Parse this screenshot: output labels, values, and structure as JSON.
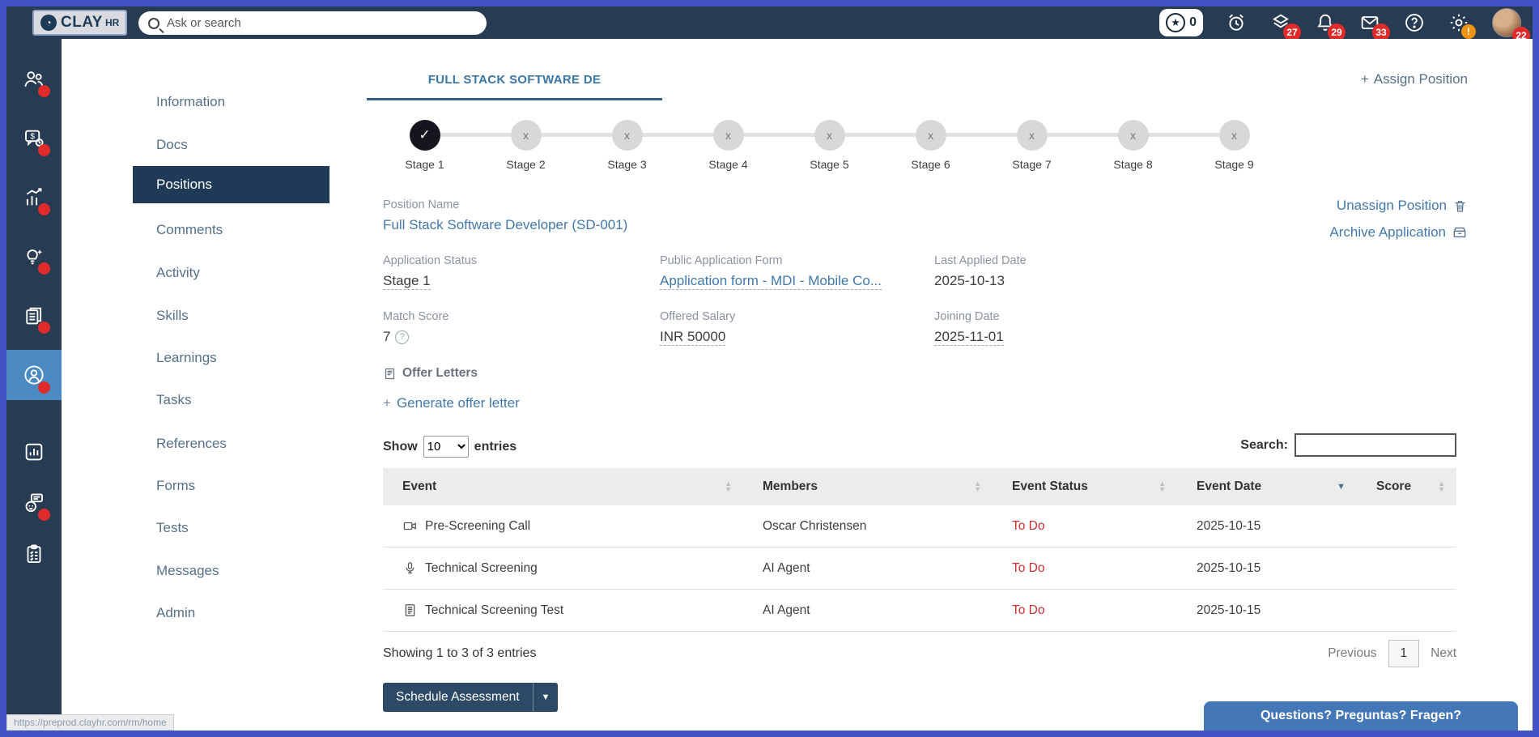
{
  "colors": {
    "frame_border": "#4353c4",
    "topbar_bg": "#273b52",
    "sidebar_selected_bg": "#4b8bc2",
    "subnav_selected_bg": "#1f3a57",
    "link_blue": "#4279ab",
    "tab_blue": "#3a76a8",
    "status_red": "#cb2e2e",
    "badge_red": "#e12a2a",
    "badge_orange": "#f0930f",
    "stage_done_bg": "#15151e",
    "stage_pending_bg": "#d8d8d8",
    "table_header_bg": "#ececec",
    "button_navy": "#2c4a66",
    "chat_bg": "#4377b8"
  },
  "topbar": {
    "logo_text": "CLAY",
    "logo_suffix": "HR",
    "search_placeholder": "Ask or search",
    "star_count": "0",
    "badge_layers": "27",
    "badge_bell": "29",
    "badge_mail": "33",
    "badge_gear": "!",
    "badge_avatar": "22"
  },
  "sidebar": {
    "items": [
      {
        "icon": "team-icon",
        "has_alert": true
      },
      {
        "icon": "billing-chat-icon",
        "has_alert": true
      },
      {
        "icon": "performance-chart-icon",
        "has_alert": true
      },
      {
        "icon": "idea-bulb-icon",
        "has_alert": true
      },
      {
        "icon": "documents-icon",
        "has_alert": true
      },
      {
        "icon": "people-profile-icon",
        "has_alert": true,
        "selected": true
      },
      {
        "icon": "analytics-icon",
        "has_alert": false
      },
      {
        "icon": "bot-assistant-icon",
        "has_alert": true
      },
      {
        "icon": "checklist-icon",
        "has_alert": false
      }
    ]
  },
  "subnav": {
    "items": [
      "Information",
      "Docs",
      "Positions",
      "Comments",
      "Activity",
      "Skills",
      "Learnings",
      "Tasks",
      "References",
      "Forms",
      "Tests",
      "Messages",
      "Admin"
    ],
    "active_item": "Positions"
  },
  "main": {
    "tab_label": "FULL STACK SOFTWARE DE",
    "assign_position_label": "Assign Position",
    "stages": [
      {
        "label": "Stage 1",
        "marker": "✓",
        "state": "done"
      },
      {
        "label": "Stage 2",
        "marker": "x",
        "state": "pending"
      },
      {
        "label": "Stage 3",
        "marker": "x",
        "state": "pending"
      },
      {
        "label": "Stage 4",
        "marker": "x",
        "state": "pending"
      },
      {
        "label": "Stage 5",
        "marker": "x",
        "state": "pending"
      },
      {
        "label": "Stage 6",
        "marker": "x",
        "state": "pending"
      },
      {
        "label": "Stage 7",
        "marker": "x",
        "state": "pending"
      },
      {
        "label": "Stage 8",
        "marker": "x",
        "state": "pending"
      },
      {
        "label": "Stage 9",
        "marker": "x",
        "state": "pending"
      }
    ],
    "position_name": {
      "label": "Position Name",
      "value": "Full Stack Software Developer (SD-001)"
    },
    "unassign_label": "Unassign Position",
    "archive_label": "Archive Application",
    "fields": {
      "application_status": {
        "label": "Application Status",
        "value": "Stage 1"
      },
      "public_application_form": {
        "label": "Public Application Form",
        "value": "Application form - MDI - Mobile Co..."
      },
      "last_applied_date": {
        "label": "Last Applied Date",
        "value": "2025-10-13"
      },
      "match_score": {
        "label": "Match Score",
        "value": "7"
      },
      "offered_salary": {
        "label": "Offered Salary",
        "value": "INR 50000"
      },
      "joining_date": {
        "label": "Joining Date",
        "value": "2025-11-01"
      }
    },
    "offer_letters_label": "Offer Letters",
    "generate_offer_label": "Generate offer letter",
    "table": {
      "show_label": "Show",
      "page_size": "10",
      "entries_label": "entries",
      "search_label": "Search:",
      "columns": [
        "Event",
        "Members",
        "Event Status",
        "Event Date",
        "Score"
      ],
      "sorted_column": "Event Date",
      "rows": [
        {
          "icon": "video-camera-icon",
          "event": "Pre-Screening Call",
          "members": "Oscar Christensen",
          "status": "To Do",
          "date": "2025-10-15",
          "score": ""
        },
        {
          "icon": "microphone-icon",
          "event": "Technical Screening",
          "members": "AI Agent",
          "status": "To Do",
          "date": "2025-10-15",
          "score": ""
        },
        {
          "icon": "test-document-icon",
          "event": "Technical Screening Test",
          "members": "AI Agent",
          "status": "To Do",
          "date": "2025-10-15",
          "score": ""
        }
      ],
      "summary": "Showing 1 to 3 of 3 entries",
      "previous_label": "Previous",
      "current_page": "1",
      "next_label": "Next"
    },
    "schedule_button_label": "Schedule Assessment"
  },
  "chat_widget_label": "Questions? Preguntas? Fragen?",
  "url_tooltip": "https://preprod.clayhr.com/rm/home"
}
